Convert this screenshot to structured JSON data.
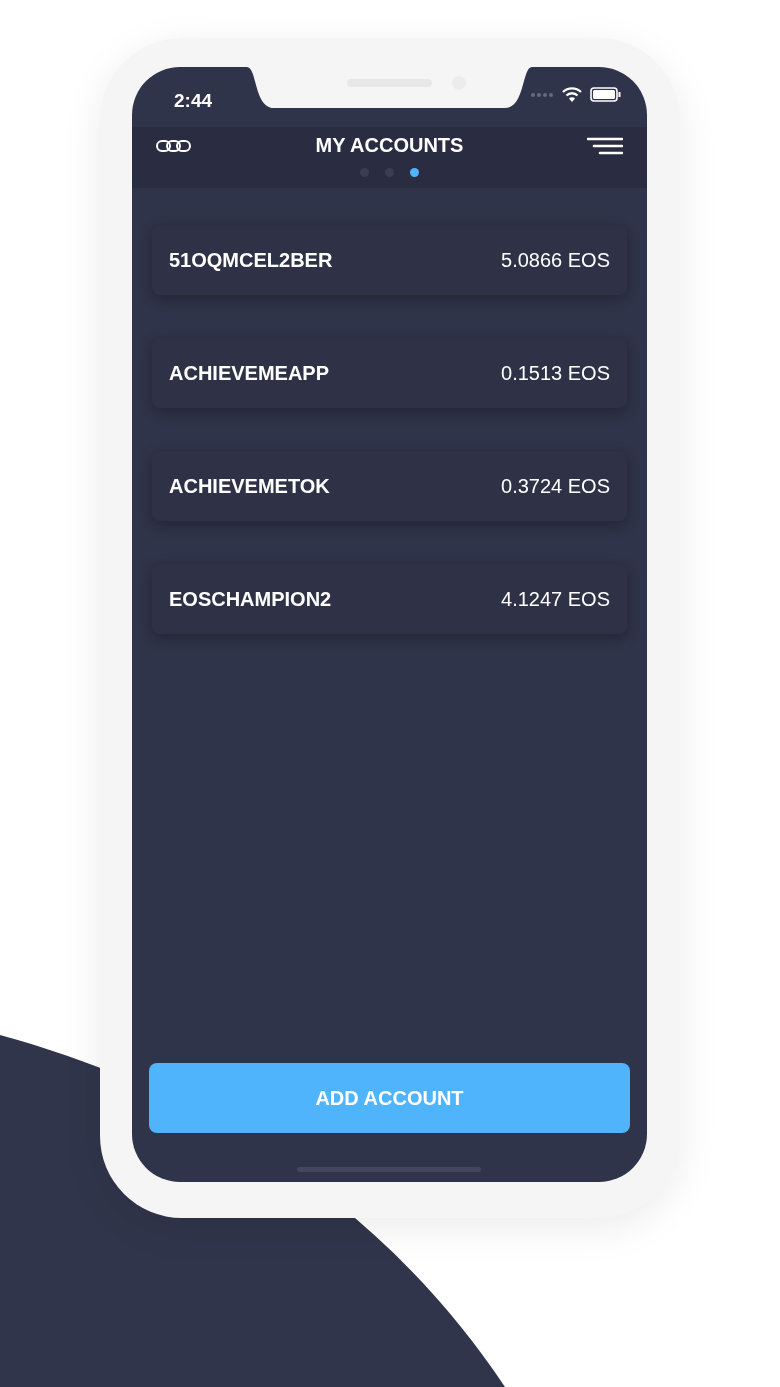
{
  "status_bar": {
    "time": "2:44"
  },
  "header": {
    "title": "MY ACCOUNTS",
    "page_dots": [
      {
        "selected": false
      },
      {
        "selected": false
      },
      {
        "selected": true
      }
    ]
  },
  "accounts": [
    {
      "name": "51OQMCEL2BER",
      "balance": "5.0866 EOS"
    },
    {
      "name": "ACHIEVEMEAPP",
      "balance": "0.1513 EOS"
    },
    {
      "name": "ACHIEVEMETOK",
      "balance": "0.3724 EOS"
    },
    {
      "name": "EOSCHAMPION2",
      "balance": "4.1247 EOS"
    }
  ],
  "add_button": {
    "label": "ADD ACCOUNT"
  }
}
